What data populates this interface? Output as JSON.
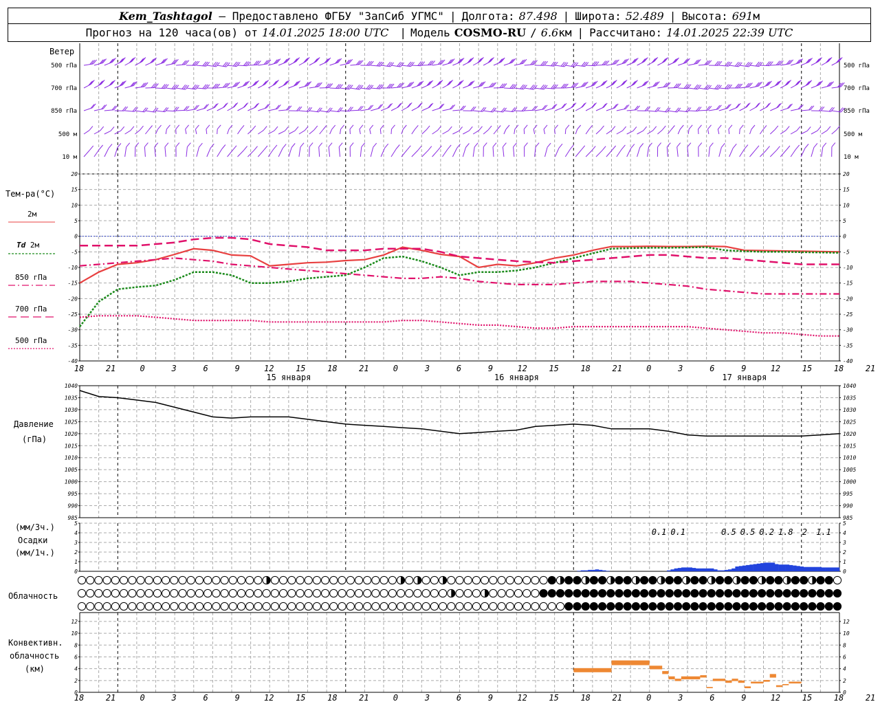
{
  "header": {
    "station": "Kem_Tashtagol",
    "dash": " — ",
    "provider": "Предоставлено ФГБУ \"ЗапСиб УГМС\"",
    "lon_label": "Долгота:",
    "lon": "87.498",
    "lat_label": "Широта:",
    "lat": "52.489",
    "alt_label": "Высота:",
    "alt": "691",
    "alt_unit": "м",
    "forecast_prefix": "Прогноз на 120 часа(ов) от",
    "forecast_start": "14.01.2025 18:00 UTC",
    "model_label": "Модель",
    "model": "COSMO-RU",
    "resolution": "6.6",
    "res_unit": "км",
    "computed_label": "Рассчитано:",
    "computed": "14.01.2025 22:39 UTC",
    "sep": "|"
  },
  "labels": {
    "wind": "Ветер",
    "temp": "Тем-ра(°C)",
    "t2m": "2м",
    "td": "Td",
    "td2m": "2м",
    "t850": "850 гПа",
    "t700": "700 гПа",
    "t500": "500 гПа",
    "pressure": "Давление",
    "pressure_unit": "(гПа)",
    "precip_unit3": "(мм/3ч.)",
    "precip": "Осадки",
    "precip_unit1": "(мм/1ч.)",
    "clouds": "Облачность",
    "conv1": "Конвективн.",
    "conv2": "облачность",
    "conv3": "(км)"
  },
  "colors": {
    "wind": "#8a2be2",
    "t2m": "#e84040",
    "td": "#1a8a1a",
    "t850": "#e0106a",
    "t700": "#e0106a",
    "t500": "#e0106a",
    "pressure": "#000000",
    "precip": "#2244dd",
    "conv": "#ee8833",
    "zero_line": "#3344cc"
  },
  "chart_data": [
    {
      "type": "barbs",
      "levels": [
        "500 гПа",
        "700 гПа",
        "850 гПа",
        "500 м",
        "10 м"
      ]
    },
    {
      "type": "line",
      "ylim": [
        -40,
        20
      ],
      "yticks": [
        20,
        15,
        10,
        5,
        0,
        -5,
        -10,
        -15,
        -20,
        -25,
        -30,
        -35,
        -40
      ],
      "x_hours": [
        0,
        3,
        6,
        9,
        12,
        15,
        18,
        21,
        24,
        27,
        30,
        33,
        36,
        39,
        42,
        45,
        48,
        51,
        54,
        57,
        60,
        63,
        66,
        69,
        72,
        75,
        78,
        81,
        84,
        87,
        90,
        93,
        96,
        99,
        102,
        105,
        108,
        111,
        114,
        117,
        120
      ],
      "x_tick_labels": [
        "18",
        "21",
        "0",
        "3",
        "6",
        "9",
        "12",
        "15",
        "18",
        "21",
        "0",
        "3",
        "6",
        "9",
        "12",
        "15",
        "18",
        "21",
        "0",
        "3",
        "6",
        "9",
        "12",
        "15",
        "18",
        "21",
        "0"
      ],
      "day_labels": [
        "15 января",
        "16 января",
        "17 января"
      ],
      "series": [
        {
          "name": "2м",
          "values": [
            -15,
            -11.5,
            -9,
            -8.5,
            -7.5,
            -5.8,
            -4,
            -4.5,
            -6,
            -6.3,
            -9.5,
            -9,
            -8.5,
            -8.3,
            -7.8,
            -7.5,
            -6,
            -3.5,
            -4.5,
            -5.8,
            -6.5,
            -10,
            -9,
            -9.5,
            -8.5,
            -7,
            -6,
            -4.5,
            -3.3,
            -3.3,
            -3.2,
            -3.3,
            -3.3,
            -3.2,
            -3.3,
            -4.5,
            -4.6,
            -4.7,
            -4.8,
            -4.9,
            -5
          ]
        },
        {
          "name": "Td 2м",
          "values": [
            -29,
            -21,
            -17,
            -16.3,
            -15.8,
            -14,
            -11.5,
            -11.5,
            -12.5,
            -15,
            -15,
            -14.5,
            -13.5,
            -13,
            -12.5,
            -10,
            -7,
            -6.5,
            -8,
            -10,
            -12.5,
            -11.5,
            -11.5,
            -11,
            -10,
            -8.5,
            -7,
            -5.5,
            -4,
            -3.8,
            -3.7,
            -3.7,
            -3.6,
            -3.5,
            -4.5,
            -4.8,
            -5,
            -5,
            -5.1,
            -5.2,
            -5.3
          ]
        },
        {
          "name": "850 гПа",
          "values": [
            -9.5,
            -9,
            -8.5,
            -8,
            -7.5,
            -7,
            -7.5,
            -8,
            -9,
            -9.5,
            -10,
            -10.5,
            -11,
            -11.5,
            -12,
            -12.5,
            -13,
            -13.5,
            -13.5,
            -13,
            -13.5,
            -14.5,
            -15,
            -15.5,
            -15.5,
            -15.5,
            -15,
            -14.5,
            -14.5,
            -14.5,
            -15,
            -15.5,
            -16,
            -17,
            -17.5,
            -18,
            -18.5,
            -18.5,
            -18.5,
            -18.5,
            -18.5
          ]
        },
        {
          "name": "700 гПа",
          "values": [
            -3,
            -3,
            -3,
            -3,
            -2.5,
            -2,
            -1,
            -0.5,
            -0.5,
            -1,
            -2.5,
            -3,
            -3.5,
            -4.5,
            -4.5,
            -4.5,
            -4,
            -4,
            -4,
            -5,
            -6.5,
            -7,
            -7.5,
            -8,
            -8.3,
            -8.5,
            -8,
            -7.5,
            -7,
            -6.5,
            -6,
            -6,
            -6.5,
            -7,
            -7,
            -7.5,
            -8,
            -8.5,
            -9,
            -9,
            -9
          ]
        },
        {
          "name": "500 гПа",
          "values": [
            -26,
            -25.5,
            -25.5,
            -25.5,
            -26,
            -26.5,
            -27,
            -27,
            -27,
            -27,
            -27.5,
            -27.5,
            -27.5,
            -27.5,
            -27.5,
            -27.5,
            -27.5,
            -27,
            -27,
            -27.5,
            -28,
            -28.5,
            -28.5,
            -29,
            -29.5,
            -29.5,
            -29,
            -29,
            -29,
            -29,
            -29,
            -29,
            -29,
            -29.5,
            -30,
            -30.5,
            -31,
            -31,
            -31.5,
            -32,
            -32
          ]
        }
      ]
    },
    {
      "type": "line",
      "ylim": [
        985,
        1040
      ],
      "yticks": [
        1040,
        1035,
        1030,
        1025,
        1020,
        1015,
        1010,
        1005,
        1000,
        995,
        990,
        985
      ],
      "x_hours": [
        0,
        3,
        6,
        9,
        12,
        15,
        18,
        21,
        24,
        27,
        30,
        33,
        36,
        39,
        42,
        45,
        48,
        51,
        54,
        57,
        60,
        63,
        66,
        69,
        72,
        75,
        78,
        81,
        84,
        87,
        90,
        93,
        96,
        99,
        102,
        105,
        108,
        111,
        114,
        117,
        120
      ],
      "x_tick_labels": [
        "18",
        "21",
        "0",
        "3",
        "6",
        "9",
        "12",
        "15",
        "18",
        "21",
        "0",
        "3",
        "6",
        "9",
        "12",
        "15",
        "18",
        "21",
        "0",
        "3",
        "6",
        "9",
        "12",
        "15",
        "18",
        "21",
        "0"
      ],
      "series": [
        {
          "name": "Давление",
          "values": [
            1038,
            1035.5,
            1035,
            1034,
            1033,
            1031,
            1029,
            1027,
            1026.5,
            1027,
            1027,
            1027,
            1026,
            1025,
            1024,
            1023.5,
            1023,
            1022.5,
            1022,
            1021,
            1020,
            1020.5,
            1021,
            1021.5,
            1023,
            1023.5,
            1024,
            1023.5,
            1022,
            1022,
            1022,
            1021,
            1019.5,
            1019,
            1019,
            1019,
            1019,
            1019,
            1019,
            1019.5,
            1020
          ]
        }
      ]
    },
    {
      "type": "bar",
      "ylim": [
        0,
        5
      ],
      "yticks": [
        5,
        4,
        3,
        2,
        1,
        0
      ],
      "x_tick_labels": [
        "18",
        "21",
        "0",
        "3",
        "6",
        "9",
        "12",
        "15",
        "18",
        "21",
        "0",
        "3",
        "6",
        "9",
        "12",
        "15",
        "18",
        "21",
        "0",
        "3",
        "6",
        "9",
        "12",
        "15",
        "18",
        "21",
        "0"
      ],
      "bars_1h_start_hour": 78,
      "values_1h": [
        0,
        0.05,
        0.1,
        0.1,
        0.15,
        0.15,
        0.2,
        0.15,
        0.1,
        0.05,
        0,
        0,
        0,
        0,
        0,
        0,
        0,
        0,
        0,
        0,
        0,
        0,
        0,
        0,
        0,
        0,
        0.1,
        0.2,
        0.3,
        0.35,
        0.4,
        0.4,
        0.4,
        0.35,
        0.3,
        0.3,
        0.3,
        0.3,
        0.3,
        0.2,
        0.1,
        0.1,
        0.15,
        0.2,
        0.3,
        0.5,
        0.55,
        0.6,
        0.65,
        0.7,
        0.75,
        0.8,
        0.85,
        0.9,
        0.9,
        0.9,
        0.75,
        0.7,
        0.7,
        0.7,
        0.65,
        0.6,
        0.55,
        0.5,
        0.45,
        0.45,
        0.45,
        0.45,
        0.45,
        0.4,
        0.4,
        0.4,
        0.4,
        0.4
      ],
      "sum_3h_labels": [
        {
          "hour": 91.5,
          "text": "0.1"
        },
        {
          "hour": 94.5,
          "text": "0.1"
        },
        {
          "hour": 102.5,
          "text": "0.5"
        },
        {
          "hour": 105.5,
          "text": "0.5"
        },
        {
          "hour": 108.5,
          "text": "0.2"
        },
        {
          "hour": 111.5,
          "text": "1.8"
        },
        {
          "hour": 114.5,
          "text": "2"
        },
        {
          "hour": 117.5,
          "text": "1.1"
        }
      ]
    },
    {
      "type": "table",
      "rows": [
        "upper",
        "middle",
        "lower"
      ],
      "cover_levels": [
        "0",
        "1/4",
        "1/2",
        "3/4",
        "1"
      ]
    },
    {
      "type": "bar",
      "ylim": [
        0,
        13
      ],
      "yticks": [
        12,
        10,
        8,
        6,
        4,
        2,
        0
      ],
      "x_tick_labels": [
        "18",
        "21",
        "0",
        "3",
        "6",
        "9",
        "12",
        "15",
        "18",
        "21",
        "0",
        "3",
        "6",
        "9",
        "12",
        "15",
        "18",
        "21",
        "0",
        "3",
        "6",
        "9",
        "12",
        "15",
        "18",
        "21",
        "0"
      ],
      "segments": [
        {
          "from": 78,
          "to": 81,
          "base": 3.4,
          "top": 4.1
        },
        {
          "from": 81,
          "to": 84,
          "base": 3.4,
          "top": 4.1
        },
        {
          "from": 84,
          "to": 87,
          "base": 4.6,
          "top": 5.4
        },
        {
          "from": 87,
          "to": 90,
          "base": 4.6,
          "top": 5.4
        },
        {
          "from": 90,
          "to": 92,
          "base": 3.9,
          "top": 4.5
        },
        {
          "from": 92,
          "to": 93,
          "base": 3.1,
          "top": 3.6
        },
        {
          "from": 93,
          "to": 94,
          "base": 2.2,
          "top": 2.7
        },
        {
          "from": 94,
          "to": 95,
          "base": 1.9,
          "top": 2.3
        },
        {
          "from": 95,
          "to": 98,
          "base": 2.2,
          "top": 2.7
        },
        {
          "from": 98,
          "to": 99,
          "base": 2.5,
          "top": 2.9
        },
        {
          "from": 99,
          "to": 100,
          "base": 0.7,
          "top": 0.9
        },
        {
          "from": 100,
          "to": 102,
          "base": 1.9,
          "top": 2.3
        },
        {
          "from": 102,
          "to": 103,
          "base": 1.6,
          "top": 2
        },
        {
          "from": 103,
          "to": 104,
          "base": 1.9,
          "top": 2.3
        },
        {
          "from": 104,
          "to": 105,
          "base": 1.6,
          "top": 2
        },
        {
          "from": 105,
          "to": 106,
          "base": 0.7,
          "top": 1
        },
        {
          "from": 106,
          "to": 108,
          "base": 1.5,
          "top": 1.8
        },
        {
          "from": 108,
          "to": 109,
          "base": 1.8,
          "top": 2.1
        },
        {
          "from": 109,
          "to": 110,
          "base": 2.5,
          "top": 3.1
        },
        {
          "from": 110,
          "to": 111,
          "base": 0.9,
          "top": 1.2
        },
        {
          "from": 111,
          "to": 112,
          "base": 1.2,
          "top": 1.4
        },
        {
          "from": 112,
          "to": 113,
          "base": 1.5,
          "top": 1.8
        },
        {
          "from": 113,
          "to": 114,
          "base": 1.5,
          "top": 1.8
        }
      ]
    }
  ]
}
